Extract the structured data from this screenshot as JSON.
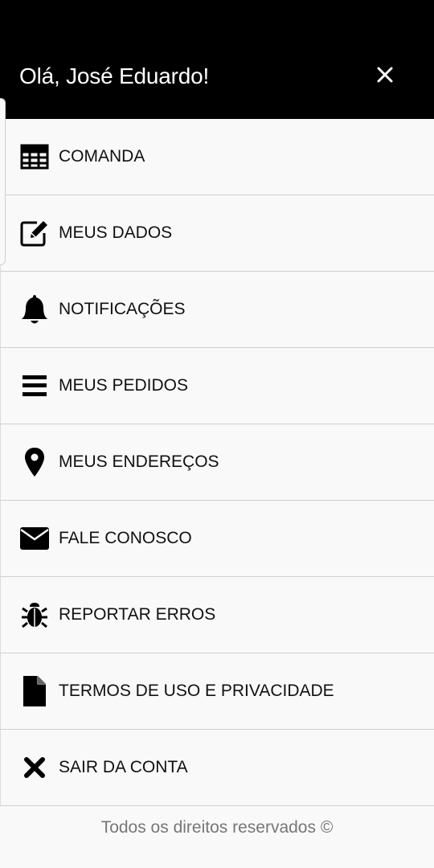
{
  "header": {
    "greeting": "Olá, José Eduardo!",
    "close_icon": "close-icon",
    "background": "#000000"
  },
  "menu": {
    "items": [
      {
        "label": "COMANDA",
        "icon": "table-grid-icon"
      },
      {
        "label": "MEUS DADOS",
        "icon": "edit-icon"
      },
      {
        "label": "NOTIFICAÇÕES",
        "icon": "bell-icon"
      },
      {
        "label": "MEUS PEDIDOS",
        "icon": "list-icon"
      },
      {
        "label": "MEUS ENDEREÇOS",
        "icon": "map-marker-icon"
      },
      {
        "label": "FALE CONOSCO",
        "icon": "envelope-icon"
      },
      {
        "label": "REPORTAR ERROS",
        "icon": "bug-icon"
      },
      {
        "label": "TERMOS DE USO E PRIVACIDADE",
        "icon": "document-icon"
      },
      {
        "label": "SAIR DA CONTA",
        "icon": "x-mark-icon"
      }
    ]
  },
  "footer": {
    "text": "Todos os direitos reservados ©"
  }
}
